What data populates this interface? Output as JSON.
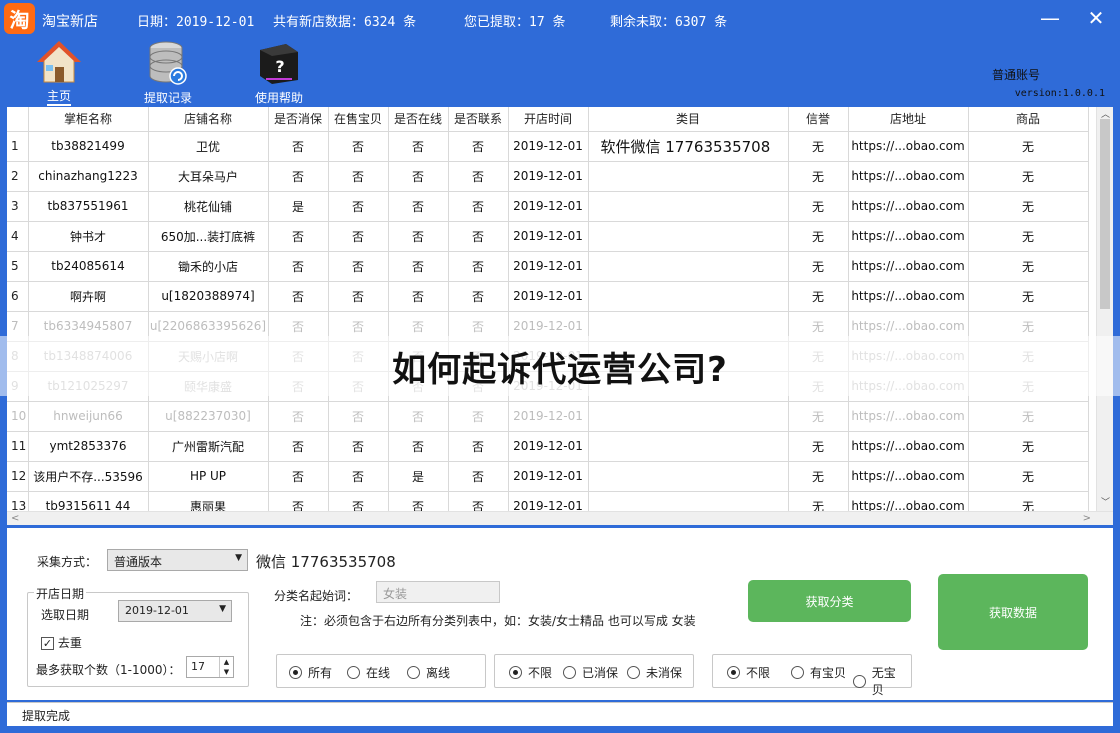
{
  "titlebar": {
    "logo_text": "淘",
    "app_title": "淘宝新店",
    "date_text": "日期：2019-12-01",
    "total_text": "共有新店数据：6324 条",
    "fetched_text": "您已提取：17 条",
    "remaining_text": "剩余未取：6307 条",
    "minimize_glyph": "—",
    "close_glyph": "✕"
  },
  "toolbar": {
    "items": [
      {
        "label": "主页",
        "icon": "house-icon"
      },
      {
        "label": "提取记录",
        "icon": "database-icon"
      },
      {
        "label": "使用帮助",
        "icon": "help-icon"
      }
    ],
    "account": "普通账号",
    "version": "version:1.0.0.1"
  },
  "grid": {
    "columns": [
      "",
      "掌柜名称",
      "店铺名称",
      "是否消保",
      "在售宝贝",
      "是否在线",
      "是否联系",
      "开店时间",
      "类目",
      "信誉",
      "店地址",
      "商品"
    ],
    "rows": [
      [
        "1",
        "tb38821499",
        "卫优",
        "否",
        "否",
        "否",
        "否",
        "2019-12-01",
        "软件微信 17763535708",
        "无",
        "https://...obao.com",
        "无"
      ],
      [
        "2",
        "chinazhang1223",
        "大耳朵马户",
        "否",
        "否",
        "否",
        "否",
        "2019-12-01",
        "",
        "无",
        "https://...obao.com",
        "无"
      ],
      [
        "3",
        "tb837551961",
        "桃花仙铺",
        "是",
        "否",
        "否",
        "否",
        "2019-12-01",
        "",
        "无",
        "https://...obao.com",
        "无"
      ],
      [
        "4",
        "钟书才",
        "650加...装打底裤",
        "否",
        "否",
        "否",
        "否",
        "2019-12-01",
        "",
        "无",
        "https://...obao.com",
        "无"
      ],
      [
        "5",
        "tb24085614",
        "锄禾的小店",
        "否",
        "否",
        "否",
        "否",
        "2019-12-01",
        "",
        "无",
        "https://...obao.com",
        "无"
      ],
      [
        "6",
        "啊卉啊",
        "u[1820388974]",
        "否",
        "否",
        "否",
        "否",
        "2019-12-01",
        "",
        "无",
        "https://...obao.com",
        "无"
      ],
      [
        "7",
        "tb6334945807",
        "u[2206863395626]",
        "否",
        "否",
        "否",
        "否",
        "2019-12-01",
        "",
        "无",
        "https://...obao.com",
        "无"
      ],
      [
        "8",
        "tb1348874006",
        "天赐小店啊",
        "否",
        "否",
        "否",
        "否",
        "2019-12-01",
        "",
        "无",
        "https://...obao.com",
        "无"
      ],
      [
        "9",
        "tb121025297",
        "颐华康盛",
        "否",
        "否",
        "否",
        "否",
        "2019-12-01",
        "",
        "无",
        "https://...obao.com",
        "无"
      ],
      [
        "10",
        "hnweijun66",
        "u[882237030]",
        "否",
        "否",
        "否",
        "否",
        "2019-12-01",
        "",
        "无",
        "https://...obao.com",
        "无"
      ],
      [
        "11",
        "ymt2853376",
        "广州雷斯汽配",
        "否",
        "否",
        "否",
        "否",
        "2019-12-01",
        "",
        "无",
        "https://...obao.com",
        "无"
      ],
      [
        "12",
        "该用户不存...53596",
        "HP UP",
        "否",
        "否",
        "是",
        "否",
        "2019-12-01",
        "",
        "无",
        "https://...obao.com",
        "无"
      ],
      [
        "13",
        "tb9315611 44",
        "惠丽果",
        "否",
        "否",
        "否",
        "否",
        "2019-12-01",
        "",
        "无",
        "https://...obao.com",
        "无"
      ]
    ],
    "dim_rows": [
      7,
      8,
      9,
      10
    ],
    "scroll_up": "︿",
    "scroll_down": "﹀",
    "scroll_left": "<",
    "scroll_right": ">"
  },
  "overlay_title": "如何起诉代运营公司?",
  "panel": {
    "collect_mode_label": "采集方式：",
    "collect_mode_value": "普通版本",
    "wechat_text": "微信 17763535708",
    "open_date_group": "开店日期",
    "select_date_label": "选取日期",
    "select_date_value": "2019-12-01",
    "dedupe_label": "去重",
    "dedupe_checked": true,
    "max_label": "最多获取个数（1-1000）：",
    "max_value": "17",
    "category_label": "分类名起始词：",
    "category_placeholder": "女装",
    "note": "注：必须包含于右边所有分类列表中，如：女装/女士精品 也可以写成 女装",
    "get_category_btn": "获取分类",
    "get_data_btn": "获取数据",
    "online_group": [
      "所有",
      "在线",
      "离线"
    ],
    "online_selected": 0,
    "guarantee_group": [
      "不限",
      "已消保",
      "未消保"
    ],
    "guarantee_selected": 0,
    "items_group": [
      "不限",
      "有宝贝",
      "无宝贝"
    ],
    "items_selected": 0
  },
  "status": "提取完成",
  "colors": {
    "accent": "#2f6bd8",
    "button_green": "#5cb65c",
    "logo_orange": "#ff6a13"
  }
}
